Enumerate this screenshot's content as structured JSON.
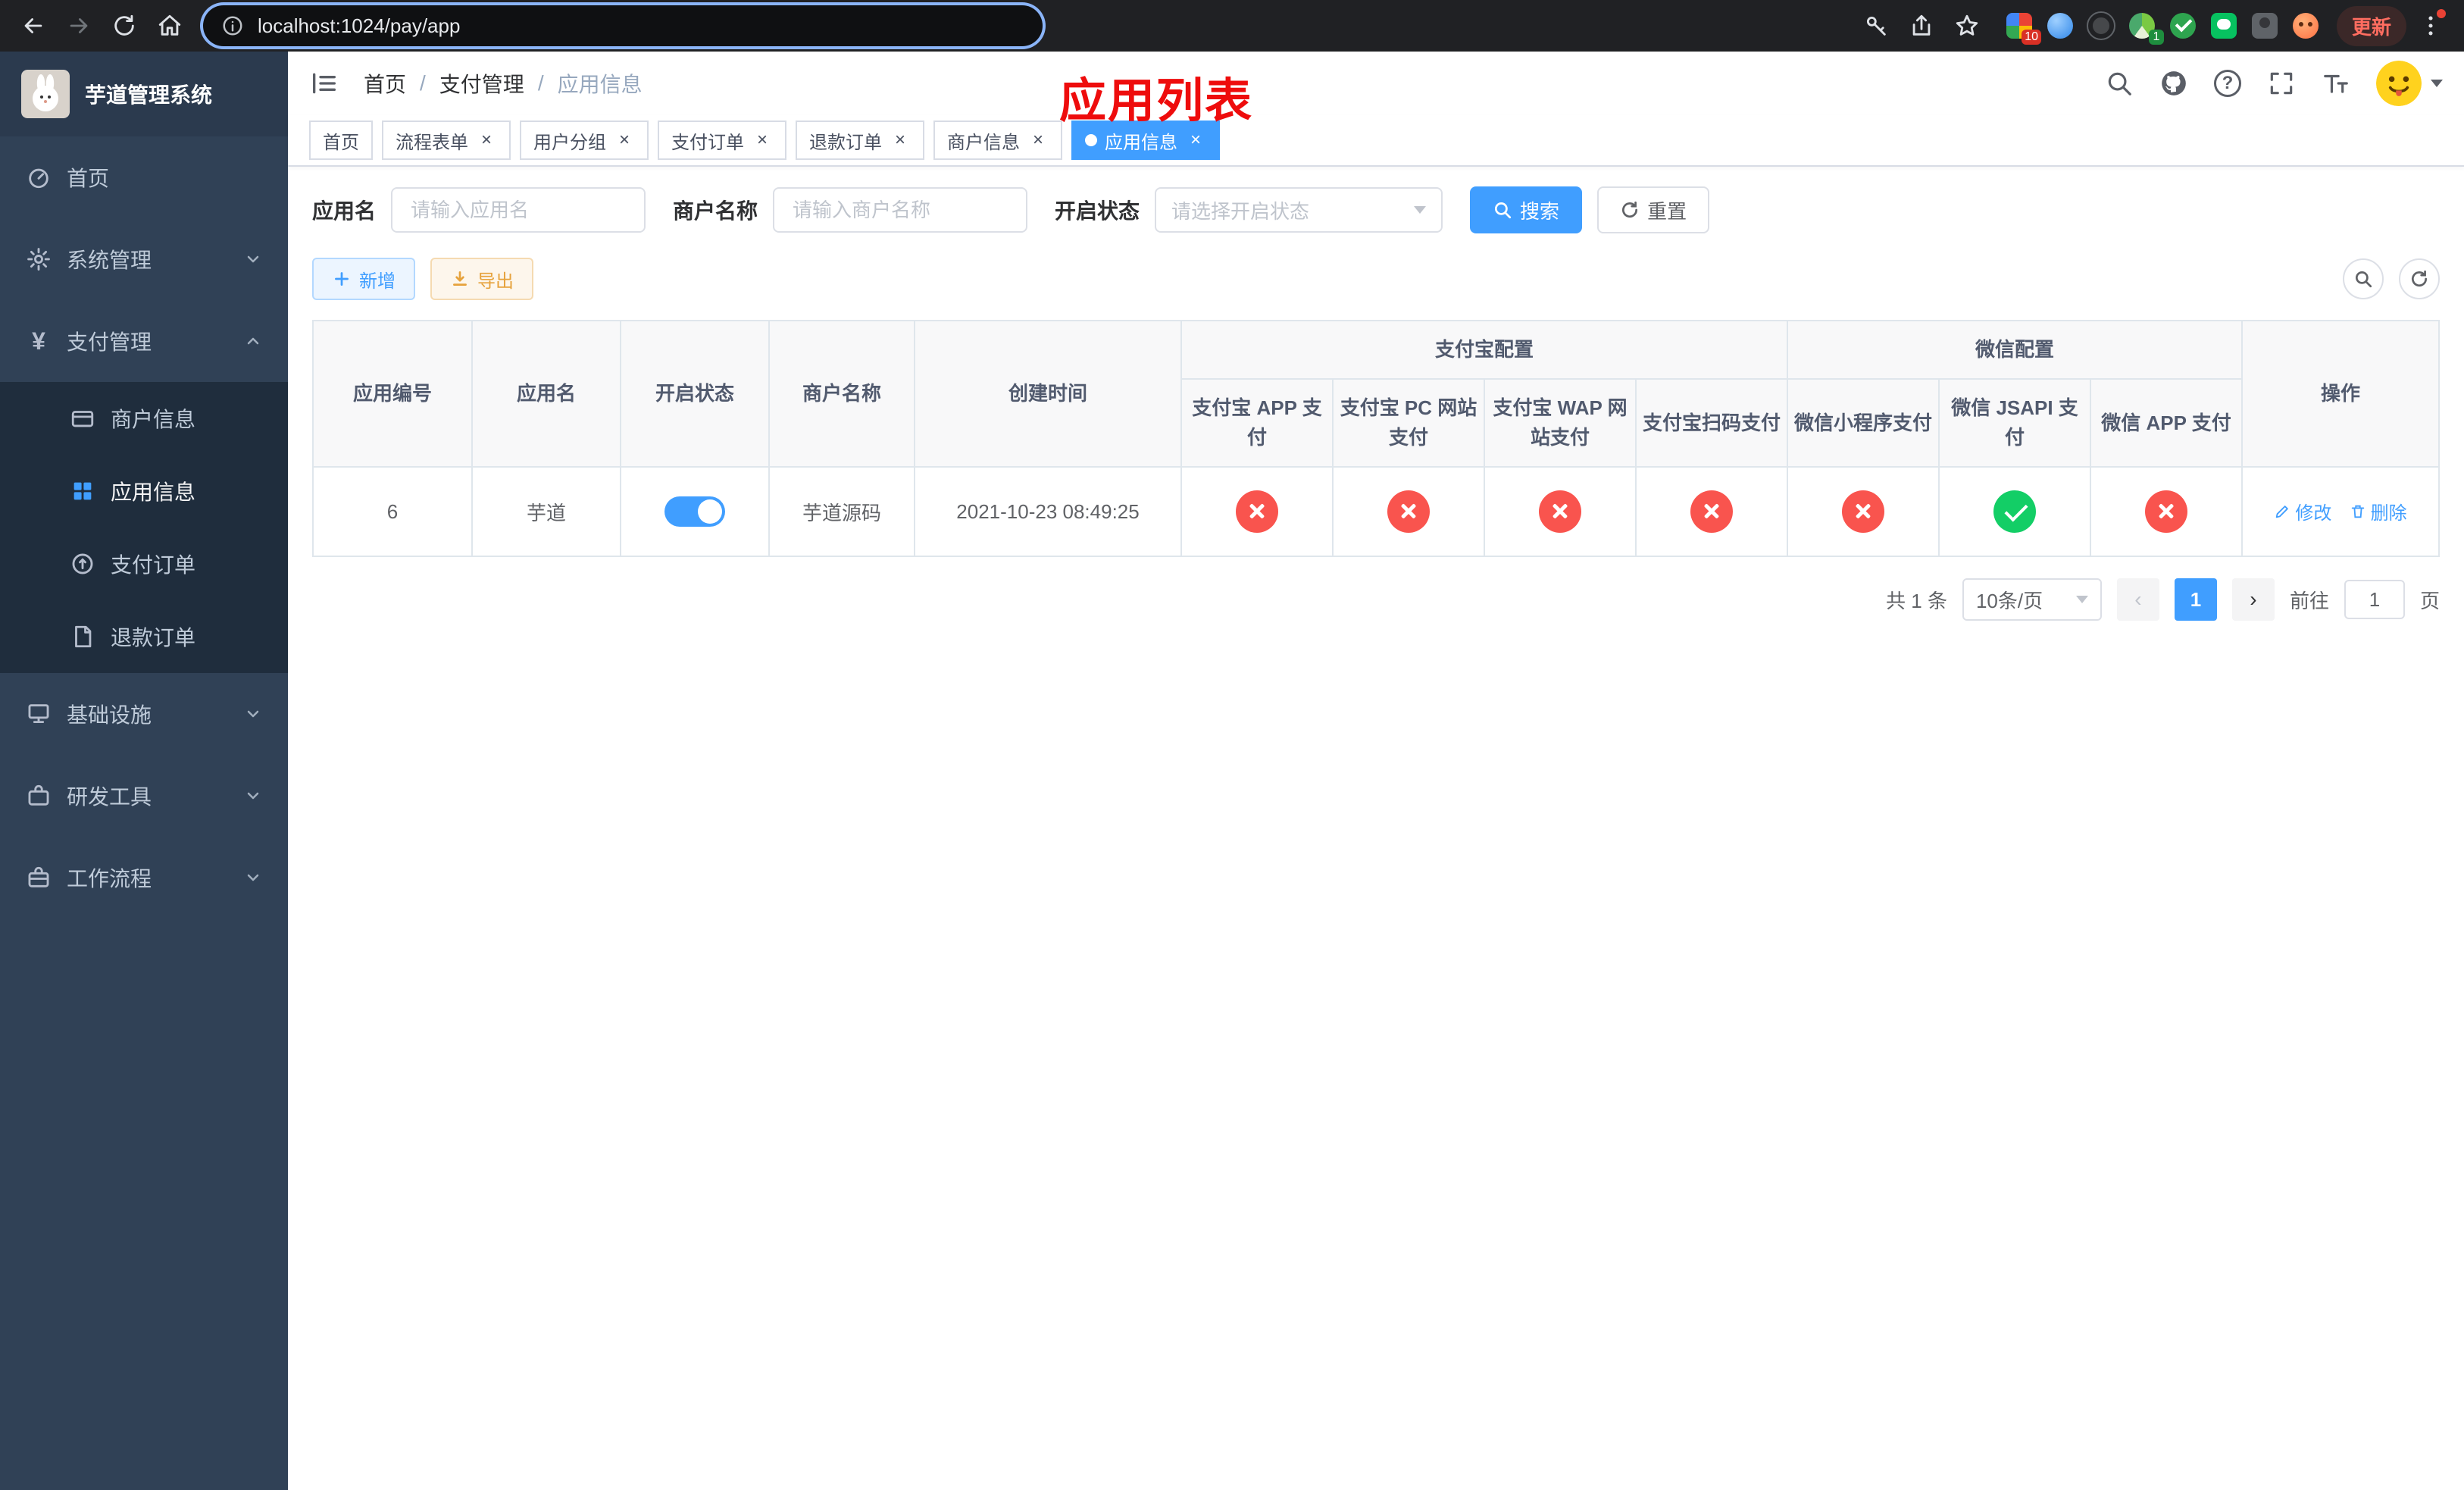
{
  "colors": {
    "accent": "#409eff",
    "status_ok": "#13ce66",
    "status_fail": "#f9544e",
    "sidebar_bg": "#304156",
    "submenu_bg": "#1f2d3d",
    "annotation_red": "#ee0c0c",
    "warning": "#e6a23c"
  },
  "browser": {
    "url": "localhost:1024/pay/app",
    "update_button": "更新",
    "extensions": [
      {
        "badge": "10"
      },
      {},
      {},
      {
        "badge": "1"
      },
      {},
      {},
      {},
      {}
    ]
  },
  "sidebar": {
    "title": "芋道管理系统",
    "items": [
      {
        "label": "首页"
      },
      {
        "label": "系统管理"
      },
      {
        "label": "支付管理"
      },
      {
        "label": "基础设施"
      },
      {
        "label": "研发工具"
      },
      {
        "label": "工作流程"
      }
    ],
    "payment_submenu": [
      {
        "label": "商户信息"
      },
      {
        "label": "应用信息"
      },
      {
        "label": "支付订单"
      },
      {
        "label": "退款订单"
      }
    ]
  },
  "header": {
    "breadcrumb": [
      "首页",
      "支付管理",
      "应用信息"
    ],
    "annotation": "应用列表"
  },
  "tabs": [
    {
      "label": "首页"
    },
    {
      "label": "流程表单"
    },
    {
      "label": "用户分组"
    },
    {
      "label": "支付订单"
    },
    {
      "label": "退款订单"
    },
    {
      "label": "商户信息"
    },
    {
      "label": "应用信息"
    }
  ],
  "filters": {
    "app_name_label": "应用名",
    "app_name_placeholder": "请输入应用名",
    "merchant_label": "商户名称",
    "merchant_placeholder": "请输入商户名称",
    "status_label": "开启状态",
    "status_placeholder": "请选择开启状态",
    "search_button": "搜索",
    "reset_button": "重置"
  },
  "toolbar": {
    "add_button": "新增",
    "export_button": "导出"
  },
  "table": {
    "groups": {
      "alipay": "支付宝配置",
      "wechat": "微信配置"
    },
    "columns": [
      "应用编号",
      "应用名",
      "开启状态",
      "商户名称",
      "创建时间",
      "支付宝 APP 支付",
      "支付宝 PC 网站支付",
      "支付宝 WAP 网站支付",
      "支付宝扫码支付",
      "微信小程序支付",
      "微信 JSAPI 支付",
      "微信 APP 支付",
      "操作"
    ],
    "row": {
      "id": "6",
      "name": "芋道",
      "enabled": true,
      "merchant": "芋道源码",
      "created": "2021-10-23 08:49:25",
      "channels": [
        "fail",
        "fail",
        "fail",
        "fail",
        "fail",
        "ok",
        "fail"
      ],
      "actions": {
        "edit": "修改",
        "delete": "删除"
      }
    }
  },
  "pagination": {
    "total": "共 1 条",
    "page_size": "10条/页",
    "page": "1",
    "goto_prefix": "前往",
    "goto_value": "1",
    "goto_suffix": "页"
  }
}
